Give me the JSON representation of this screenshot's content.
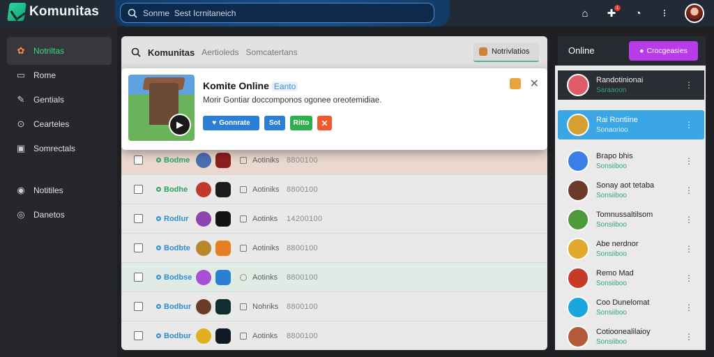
{
  "app": {
    "name": "Komunitas"
  },
  "search": {
    "placeholder": "Sonme  Sest Icrnitaneich"
  },
  "top_icons": [
    {
      "icon": "home-icon",
      "glyph": "⌂"
    },
    {
      "icon": "notification-icon",
      "glyph": "✚",
      "badge": "1"
    },
    {
      "icon": "clock-icon",
      "glyph": "◔"
    },
    {
      "icon": "more-icon",
      "glyph": "⁝"
    }
  ],
  "sidebar": {
    "items": [
      {
        "label": "Notriltas",
        "icon": "gear-icon",
        "glyph": "✿"
      },
      {
        "label": "Rome",
        "icon": "home-icon",
        "glyph": "▭"
      },
      {
        "label": "Gentials",
        "icon": "pencil-icon",
        "glyph": "✎"
      },
      {
        "label": "Cearteles",
        "icon": "lock-icon",
        "glyph": "⊙"
      },
      {
        "label": "Somrectals",
        "icon": "image-icon",
        "glyph": "▣"
      },
      {
        "label": "Notitiles",
        "icon": "profile-icon",
        "glyph": "◉"
      },
      {
        "label": "Danetos",
        "icon": "alert-icon",
        "glyph": "◎"
      }
    ]
  },
  "main": {
    "title": "Komunitas",
    "crumbs": [
      "Aertioleds",
      "Somcatertans"
    ],
    "notifications_label": "Notrivlatios"
  },
  "popup": {
    "title": "Komite Online",
    "tag": "Eanto",
    "description": "Morir Gontiar doccomponos ogonee oreotemidiae.",
    "primary_label": "Gonnrate",
    "btn2_label": "Sot",
    "btn3_label": "Ritto",
    "close_glyph": "✕"
  },
  "rows": [
    {
      "status": "Bodme",
      "status_color": "green",
      "name": "Aotiniks",
      "number": "8800100",
      "avatar1": "#4a6fb0",
      "avatar2": "#8b1f1f"
    },
    {
      "status": "Bodhe",
      "status_color": "green",
      "name": "Aotiniks",
      "number": "8800100",
      "avatar1": "#c0392b",
      "avatar2": "#2e8b3c"
    },
    {
      "status": "Rodlur",
      "status_color": "blue",
      "name": "Aotinks",
      "number": "14200100",
      "avatar1": "#8e44ad",
      "avatar2": "#eeeeee"
    },
    {
      "status": "Bodbte",
      "status_color": "blue",
      "name": "Aotiniks",
      "number": "8800100",
      "avatar1": "#b8862b",
      "avatar2": "#e67e22"
    },
    {
      "status": "Bodbse",
      "status_color": "blue",
      "name": "Aotinks",
      "number": "8800100",
      "avatar1": "#a94fd6",
      "avatar2": "#2c7fd4"
    },
    {
      "status": "Bodbur",
      "status_color": "blue",
      "name": "Nohriks",
      "number": "8800100",
      "avatar1": "#6b3b2a",
      "avatar2": "#20b2aa"
    },
    {
      "status": "Bodbur",
      "status_color": "blue",
      "name": "Aotinks",
      "number": "8800100",
      "avatar1": "#e0b020",
      "avatar2": "#2ea3f2"
    }
  ],
  "right": {
    "title": "Online",
    "button_label": "Crocgeasies",
    "items": [
      {
        "name": "Randotinionai",
        "sub": "Saraaoon",
        "avatar": "#e05a6a"
      },
      {
        "name": "Rai Rontiine",
        "sub": "Sonaorioo",
        "avatar": "#d4a030"
      },
      {
        "name": "Brapo bhis",
        "sub": "Sonsiiboo",
        "avatar": "#3b7ee8"
      },
      {
        "name": "Sonay aot tetaba",
        "sub": "Sonsiiboo",
        "avatar": "#6b3b2a"
      },
      {
        "name": "Tomnussaltilsom",
        "sub": "Sonsiiboo",
        "avatar": "#4c9a3a"
      },
      {
        "name": "Abe nerdnor",
        "sub": "Sonsiiboo",
        "avatar": "#e2a82c"
      },
      {
        "name": "Remo Mad",
        "sub": "Sonsiiboo",
        "avatar": "#c83a28"
      },
      {
        "name": "Coo Dunelomat",
        "sub": "Sonsiiboo",
        "avatar": "#1ba6e0"
      },
      {
        "name": "Cotioonealilaioy",
        "sub": "Sonsiiboo",
        "avatar": "#b35a3a"
      }
    ],
    "more_glyph": "⋮"
  }
}
